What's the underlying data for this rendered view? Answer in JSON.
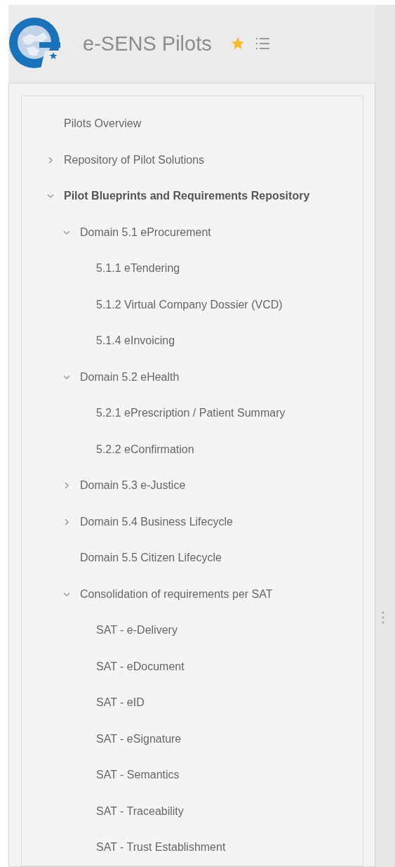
{
  "header": {
    "title": "e-SENS Pilots",
    "favorite": true
  },
  "tree": [
    {
      "label": "Pilots Overview",
      "selected": false
    },
    {
      "label": "Repository of Pilot Solutions",
      "selected": false,
      "expanded": false
    },
    {
      "label": "Pilot Blueprints and Requirements Repository",
      "selected": true,
      "expanded": true,
      "children": [
        {
          "label": "Domain 5.1 eProcurement",
          "selected": false,
          "expanded": true,
          "children": [
            {
              "label": "5.1.1 eTendering",
              "selected": false
            },
            {
              "label": "5.1.2 Virtual Company Dossier (VCD)",
              "selected": false
            },
            {
              "label": "5.1.4 eInvoicing",
              "selected": false
            }
          ]
        },
        {
          "label": "Domain 5.2 eHealth",
          "selected": false,
          "expanded": true,
          "children": [
            {
              "label": "5.2.1 ePrescription / Patient Summary",
              "selected": false
            },
            {
              "label": "5.2.2 eConfirmation",
              "selected": false
            }
          ]
        },
        {
          "label": "Domain 5.3 e-Justice",
          "selected": false,
          "expanded": false
        },
        {
          "label": "Domain 5.4 Business Lifecycle",
          "selected": false,
          "expanded": false
        },
        {
          "label": "Domain 5.5 Citizen Lifecycle",
          "selected": false
        },
        {
          "label": "Consolidation of requirements per SAT",
          "selected": false,
          "expanded": true,
          "children": [
            {
              "label": "SAT - e-Delivery",
              "selected": false
            },
            {
              "label": "SAT - eDocument",
              "selected": false
            },
            {
              "label": "SAT - eID",
              "selected": false
            },
            {
              "label": "SAT - eSignature",
              "selected": false
            },
            {
              "label": "SAT - Semantics",
              "selected": false
            },
            {
              "label": "SAT - Traceability",
              "selected": false
            },
            {
              "label": "SAT - Trust Establishment",
              "selected": false
            }
          ]
        }
      ]
    }
  ]
}
